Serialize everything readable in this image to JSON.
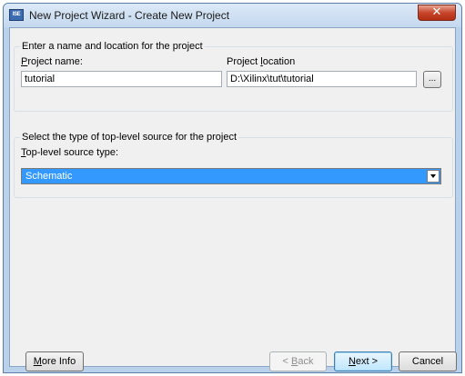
{
  "window": {
    "app_icon_text": "ISE",
    "title": "New Project Wizard - Create New Project",
    "close_glyph": "✕"
  },
  "project_group": {
    "title": "Enter a name and location for the project",
    "name_label_accel": "P",
    "name_label_rest": "roject name:",
    "name_value": "tutorial",
    "location_label_pre": "Project ",
    "location_label_accel": "l",
    "location_label_rest": "ocation",
    "location_value": "D:\\Xilinx\\tut\\tutorial",
    "browse_label": "..."
  },
  "source_group": {
    "title": "Select the type of top-level source for the project",
    "type_label_accel": "T",
    "type_label_rest": "op-level source type:",
    "selected": "Schematic"
  },
  "buttons": {
    "more_info_accel": "M",
    "more_info_rest": "ore Info",
    "back_pre": "< ",
    "back_accel": "B",
    "back_rest": "ack",
    "next_accel": "N",
    "next_rest": "ext >",
    "cancel": "Cancel"
  },
  "colors": {
    "selection": "#3399ff",
    "dialog_background": "#f0f0f0",
    "close_button": "#c7452b"
  },
  "icons": {
    "app": "ise-app-icon",
    "close": "close-icon",
    "dropdown": "chevron-down-icon"
  }
}
